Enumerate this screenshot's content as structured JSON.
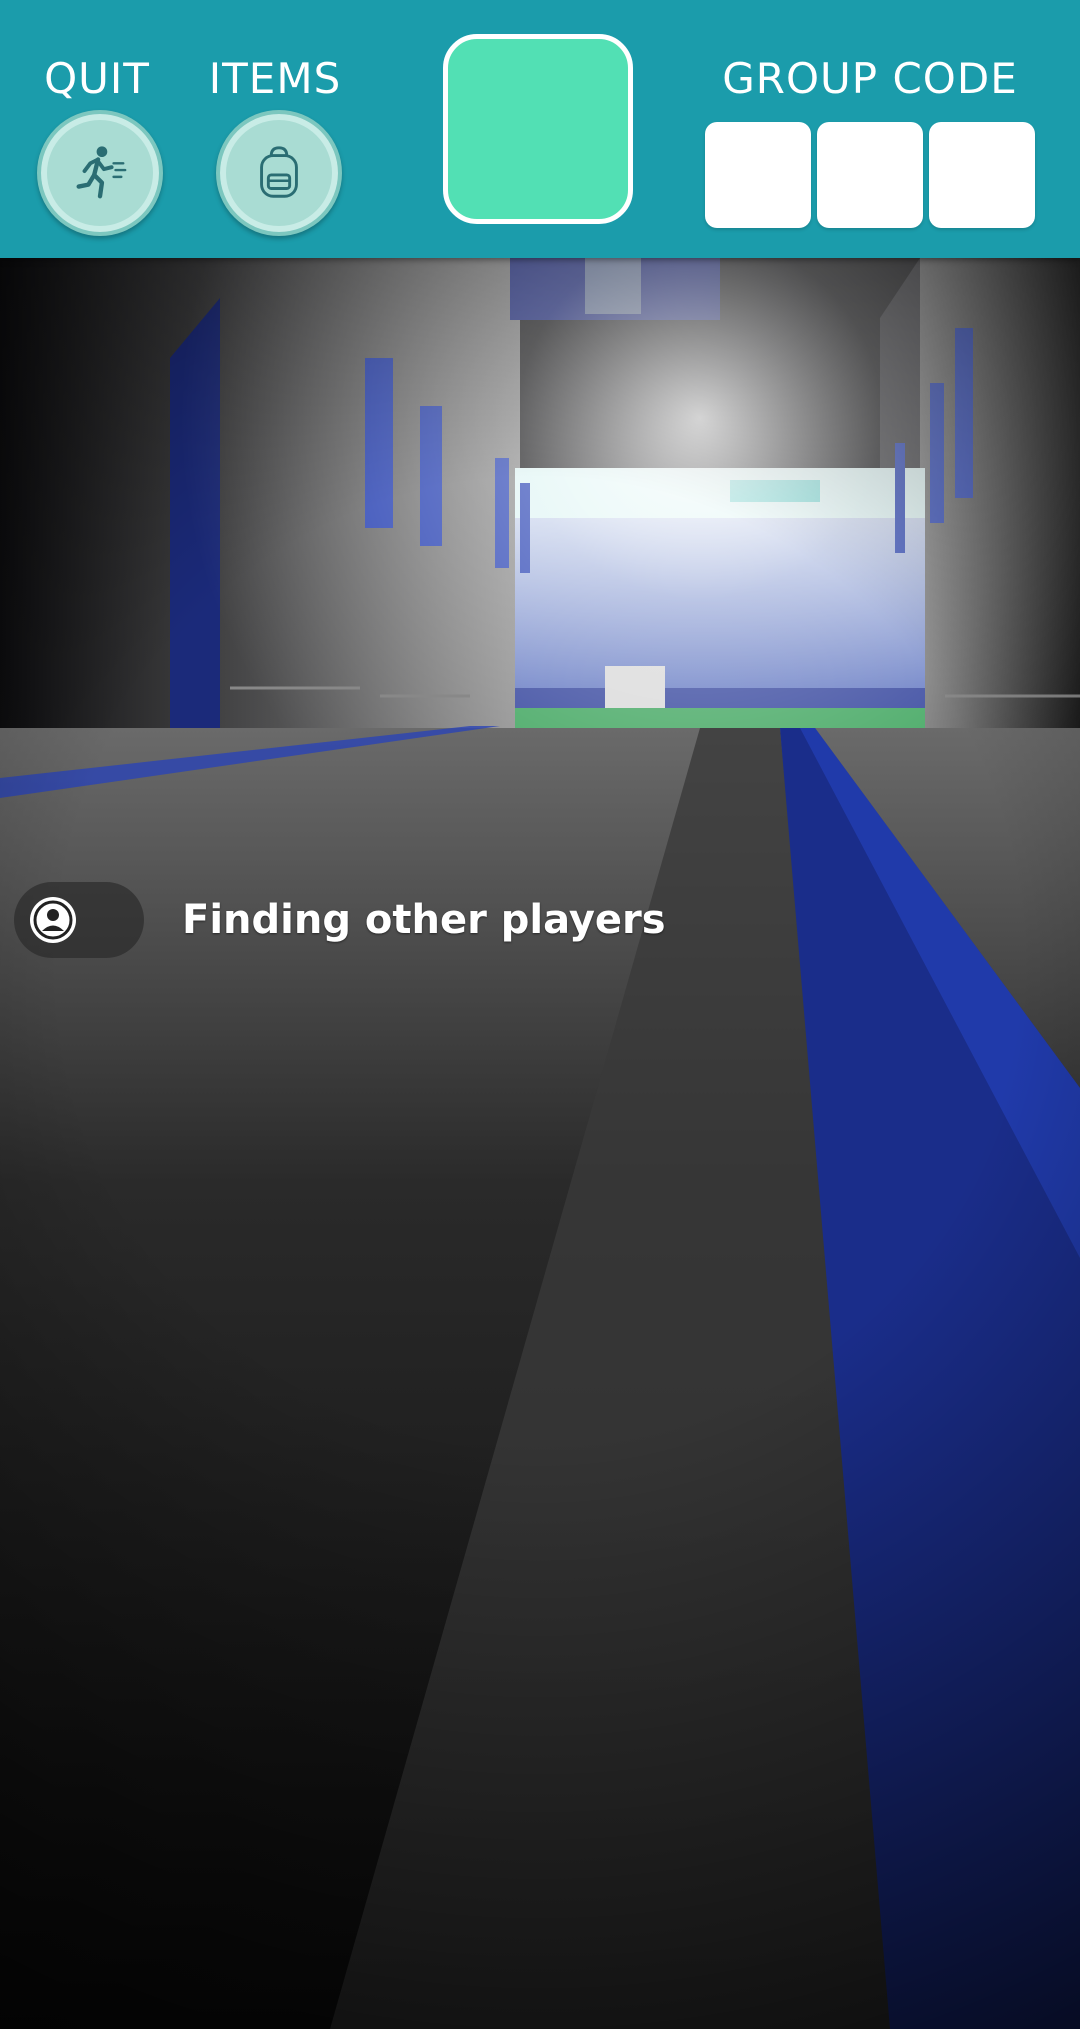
{
  "header": {
    "quit_label": "QUIT",
    "items_label": "ITEMS",
    "group_code_label": "GROUP CODE",
    "group_code_slots": [
      "",
      "",
      ""
    ],
    "colors": {
      "bar": "#1b9cab",
      "center_tile": "#52e0b4",
      "button_face": "#a9dcd3"
    },
    "icons": {
      "quit": "running-person-icon",
      "items": "backpack-icon"
    }
  },
  "status": {
    "text": "Finding other players",
    "icon": "user-icon"
  }
}
